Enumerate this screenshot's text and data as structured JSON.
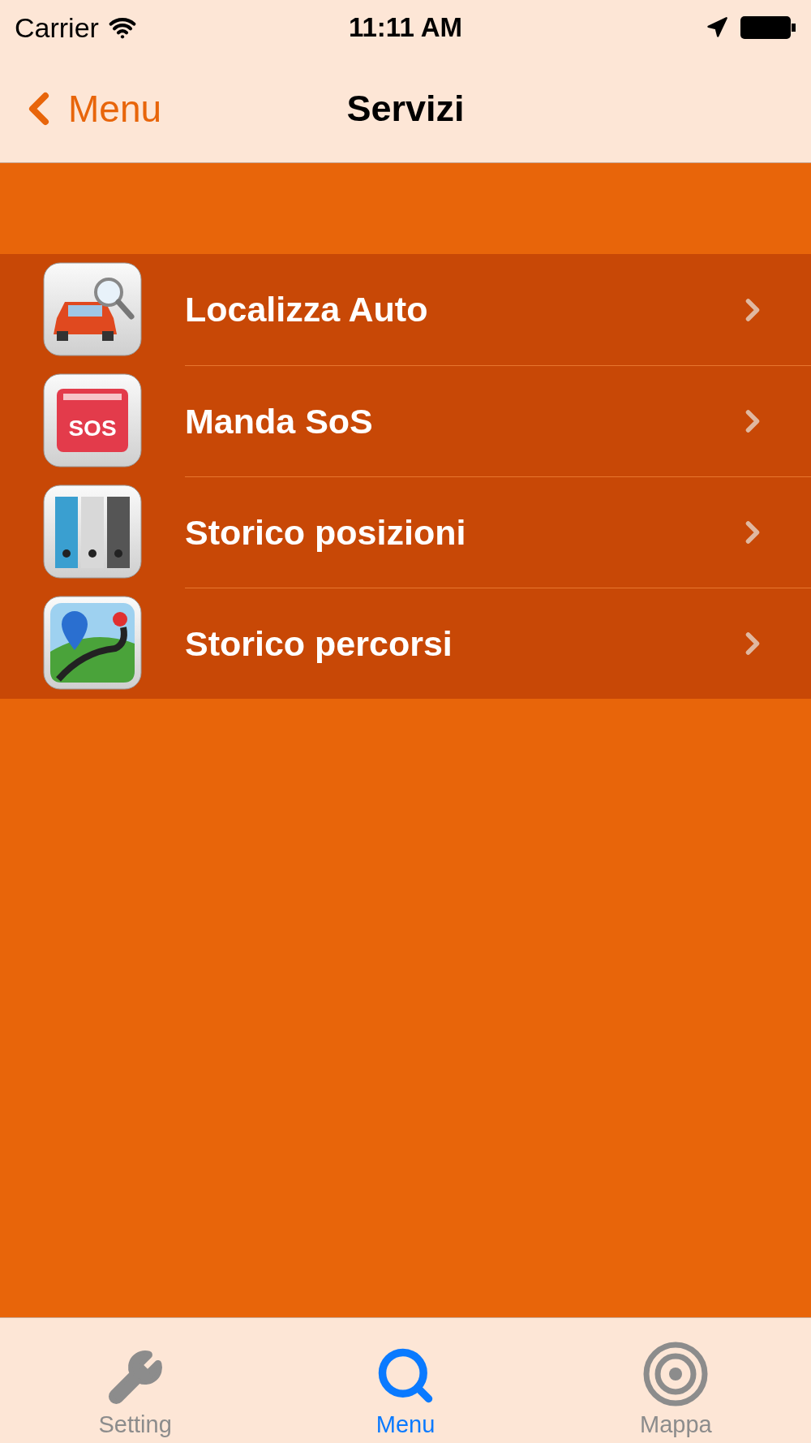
{
  "status_bar": {
    "carrier": "Carrier",
    "time": "11:11 AM"
  },
  "nav_bar": {
    "back": "Menu",
    "title": "Servizi"
  },
  "items": [
    {
      "kind": "car",
      "label": "Localizza Auto"
    },
    {
      "kind": "sos",
      "label": "Manda SoS",
      "icon_text": "SOS"
    },
    {
      "kind": "binders",
      "label": "Storico posizioni"
    },
    {
      "kind": "map",
      "label": "Storico percorsi"
    }
  ],
  "tab_bar": [
    {
      "kind": "wrench",
      "label": "Setting",
      "selected": false
    },
    {
      "kind": "search",
      "label": "Menu",
      "selected": true
    },
    {
      "kind": "target",
      "label": "Mappa",
      "selected": false
    }
  ]
}
